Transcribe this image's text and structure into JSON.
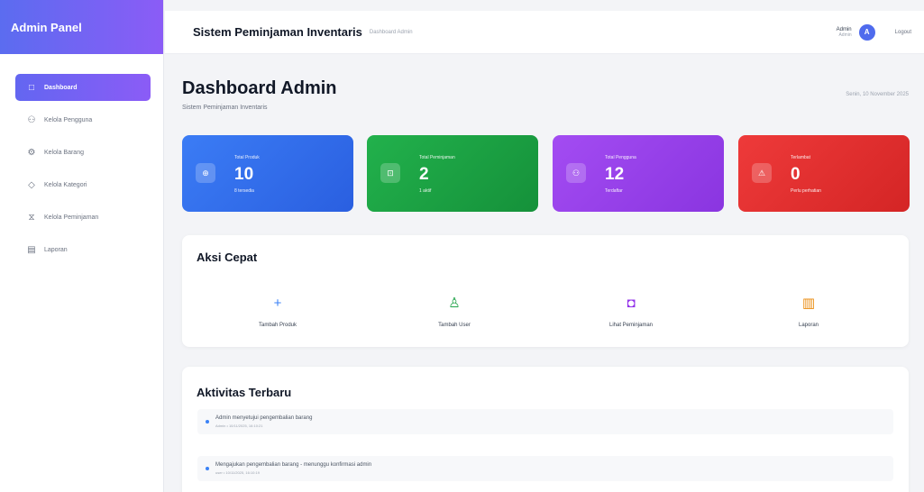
{
  "sidebar": {
    "brand": "Admin Panel",
    "items": [
      {
        "label": "Dashboard",
        "icon": "□",
        "active": true
      },
      {
        "label": "Kelola Pengguna",
        "icon": "⚇"
      },
      {
        "label": "Kelola Barang",
        "icon": "⚙"
      },
      {
        "label": "Kelola Kategori",
        "icon": "◇"
      },
      {
        "label": "Kelola Peminjaman",
        "icon": "⧖"
      },
      {
        "label": "Laporan",
        "icon": "▤"
      }
    ]
  },
  "header": {
    "title": "Sistem Peminjaman Inventaris",
    "subtitle": "Dashboard Admin",
    "user_name": "Admin",
    "user_role": "Admin",
    "avatar_initial": "A",
    "logout": "Logout"
  },
  "page": {
    "title": "Dashboard Admin",
    "subtitle": "Sistem Peminjaman Inventaris",
    "date": "Senin, 10 November 2025"
  },
  "stats": [
    {
      "label": "Total Produk",
      "value": "10",
      "note": "8 tersedia",
      "icon": "⊕",
      "color_from": "#3b7cf5",
      "color_to": "#2a5fe0"
    },
    {
      "label": "Total Peminjaman",
      "value": "2",
      "note": "1 aktif",
      "icon": "⊡",
      "color_from": "#22b14c",
      "color_to": "#15913a"
    },
    {
      "label": "Total Pengguna",
      "value": "12",
      "note": "Terdaftar",
      "icon": "⚇",
      "color_from": "#a34cf2",
      "color_to": "#8a35e0"
    },
    {
      "label": "Terlambat",
      "value": "0",
      "note": "Perlu perhatian",
      "icon": "⚠",
      "color_from": "#ee3a3a",
      "color_to": "#d42525"
    }
  ],
  "quick_actions": {
    "title": "Aksi Cepat",
    "items": [
      {
        "label": "Tambah Produk",
        "icon": "+",
        "color": "#3b82f6"
      },
      {
        "label": "Tambah User",
        "icon": "♙",
        "color": "#22a34a"
      },
      {
        "label": "Lihat Peminjaman",
        "icon": "◘",
        "color": "#9333ea"
      },
      {
        "label": "Laporan",
        "icon": "▥",
        "color": "#ea8a0c"
      }
    ]
  },
  "activity": {
    "title": "Aktivitas Terbaru",
    "items": [
      {
        "text": "Admin menyetujui pengembalian barang",
        "meta": "Admin • 10/11/2025, 16:10:21"
      },
      {
        "text": "Mengajukan pengembalian barang - menunggu konfirmasi admin",
        "meta": "user • 10/11/2025, 16:10:19"
      }
    ]
  }
}
